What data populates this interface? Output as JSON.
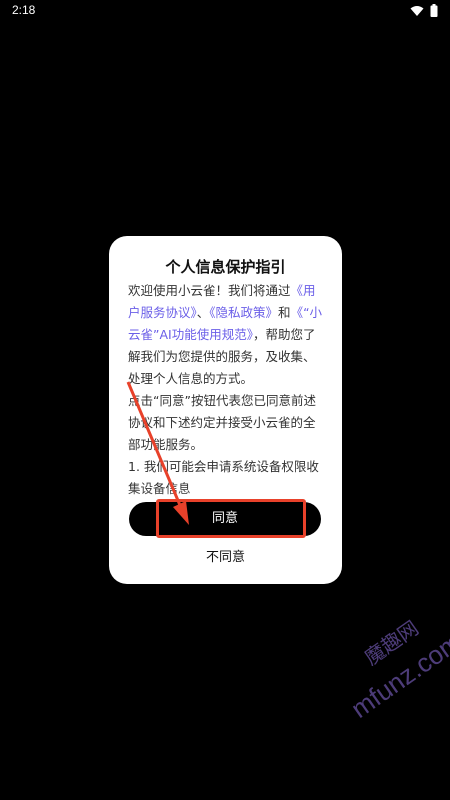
{
  "status_bar": {
    "time": "2:18"
  },
  "dialog": {
    "title": "个人信息保护指引",
    "para1": {
      "prefix": "欢迎使用小云雀！我们将通过",
      "link1": "《用户服务协议》",
      "sep1": "、",
      "link2": "《隐私政策》",
      "sep2": "和",
      "link3": "《“小云雀”AI功能使用规范》",
      "suffix": "，帮助您了解我们为您提供的服务，及收集、处理个人信息的方式。"
    },
    "para2": "点击“同意”按钮代表您已同意前述协议和下述约定并接受小云雀的全部功能服务。",
    "para3": "1. 我们可能会申请系统设备权限收集设备信息",
    "agree_label": "同意",
    "disagree_label": "不同意"
  },
  "watermark": {
    "brand_cn": "魔趣网",
    "url": "mfunz.com"
  },
  "colors": {
    "background": "#000000",
    "link": "#6b5fe8",
    "annotation": "#e8412a"
  }
}
